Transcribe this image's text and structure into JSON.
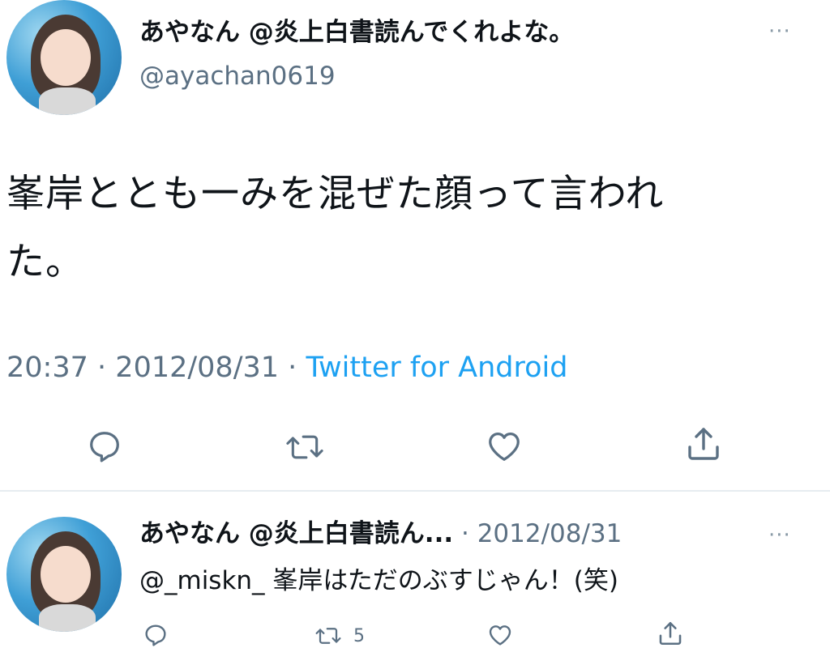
{
  "main_tweet": {
    "display_name": "あやなん @炎上白書読んでくれよな。",
    "handle": "@ayachan0619",
    "text_line1": "峯岸ととも一みを混ぜた顔って言われ",
    "text_line2": "た。",
    "time": "20:37",
    "date": "2012/08/31",
    "separator": "·",
    "source": "Twitter for Android",
    "more_label": "···"
  },
  "reply_tweet": {
    "display_name": "あやなん @炎上白書読ん...",
    "separator": "·",
    "date": "2012/08/31",
    "mention": "@_miskn_",
    "text": "峯岸はただのぶすじゃん！(笑)",
    "retweet_count": "5",
    "more_label": "···"
  },
  "icons": [
    "reply-icon",
    "retweet-icon",
    "like-icon",
    "share-icon",
    "more-icon"
  ],
  "colors": {
    "text_primary": "#0f1419",
    "text_secondary": "#5b7083",
    "link": "#1da1f2",
    "divider": "#e6ecf0"
  }
}
